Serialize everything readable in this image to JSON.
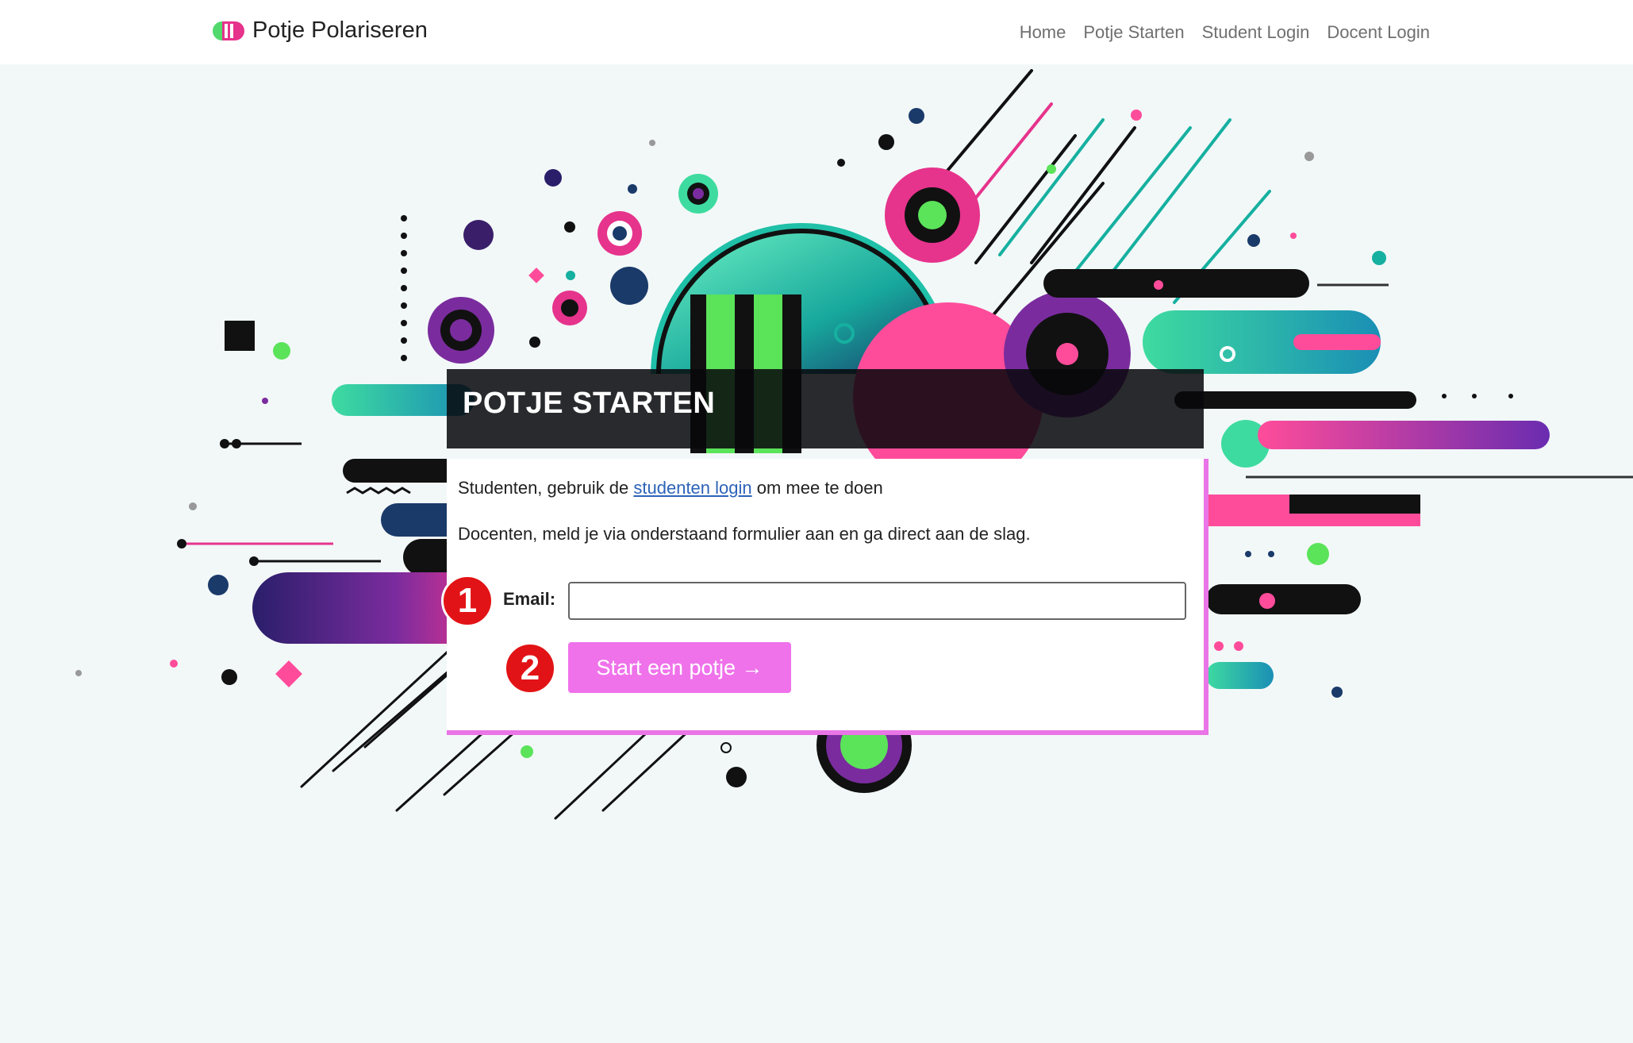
{
  "navbar": {
    "brand": "Potje Polariseren",
    "links": [
      "Home",
      "Potje Starten",
      "Student Login",
      "Docent Login"
    ]
  },
  "panel": {
    "title": "POTJE STARTEN",
    "students_text_before": "Studenten, gebruik de ",
    "students_link": "studenten login",
    "students_text_after": " om mee te doen",
    "teachers_text": "Docenten, meld je via onderstaand formulier aan en ga direct aan de slag.",
    "email_label": "Email:",
    "email_value": "",
    "start_button": "Start een potje →"
  },
  "annotations": [
    "1",
    "2"
  ],
  "colors": {
    "accent_pink": "#ef72ea",
    "panel_border": "#e975e6",
    "marker_red": "#e21316",
    "link_blue": "#2d63b8"
  }
}
